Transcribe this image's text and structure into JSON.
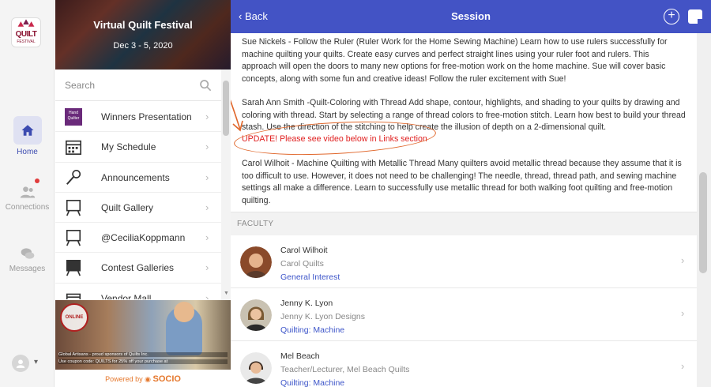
{
  "rail": {
    "logo_word": "QUILT",
    "logo_sub": "FESTIVAL",
    "items": [
      {
        "label": "Home",
        "icon": "home-icon"
      },
      {
        "label": "Connections",
        "icon": "people-icon"
      },
      {
        "label": "Messages",
        "icon": "chat-icon"
      }
    ],
    "accent": "#3c4bb0",
    "notification_color": "#e03c3c"
  },
  "event": {
    "title": "Virtual Quilt Festival",
    "dates": "Dec 3 - 5, 2020"
  },
  "search": {
    "placeholder": "Search"
  },
  "menu": {
    "items": [
      {
        "label": "Winners Presentation",
        "icon": "hq-logo-icon"
      },
      {
        "label": "My Schedule",
        "icon": "calendar-icon"
      },
      {
        "label": "Announcements",
        "icon": "microphone-icon"
      },
      {
        "label": "Quilt Gallery",
        "icon": "easel-icon"
      },
      {
        "label": "@CeciliaKoppmann",
        "icon": "easel-icon"
      },
      {
        "label": "Contest Galleries",
        "icon": "easel-icon"
      },
      {
        "label": "Vendor Mall",
        "icon": "store-icon"
      }
    ],
    "hq_logo_text": "Hand Quilter"
  },
  "ad": {
    "stamp": "ONLINE",
    "line1": "Global Artisans - proud sponsors of Quilts Inc.",
    "line2": "Use coupon code: QUILTS for 25% off your purchase at"
  },
  "powered": {
    "prefix": "Powered by",
    "brand": "SOCIO"
  },
  "topbar": {
    "back_label": "Back",
    "title": "Session",
    "color": "#4353c5"
  },
  "session": {
    "paragraphs": [
      "Sue Nickels - Follow the Ruler (Ruler Work for the Home Sewing Machine) Learn how to use rulers successfully for machine quilting your quilts. Create easy curves and perfect straight lines using your ruler foot and rulers. This approach will open the doors to many new options for free-motion work on the home machine. Sue will cover basic concepts, along with some fun and creative ideas! Follow the ruler excitement with Sue!",
      "Sarah Ann Smith -Quilt-Coloring with Thread Add shape, contour, highlights, and shading to your quilts by drawing and coloring with thread. Start by selecting a range of thread colors to free-motion stitch. Learn how best to build your thread stash. Use the direction of the stitching to help create the illusion of depth on a 2-dimensional quilt.",
      "Carol Wilhoit - Machine Quilting with Metallic Thread Many quilters avoid metallic thread because they assume that it is too difficult to use. However, it does not need to be challenging! The needle, thread, thread path, and sewing machine settings all make a difference. Learn to successfully use metallic thread for both walking foot quilting and free-motion quilting."
    ],
    "update_note": "UPDATE! Please see video below in Links section",
    "update_color": "#e02020",
    "annotation_color": "#e0662a"
  },
  "faculty": {
    "header": "FACULTY",
    "people": [
      {
        "name": "Carol Wilhoit",
        "org": "Carol Quilts",
        "track": "General Interest"
      },
      {
        "name": "Jenny K. Lyon",
        "org": "Jenny K. Lyon Designs",
        "track": "Quilting: Machine"
      },
      {
        "name": "Mel Beach",
        "org": "Teacher/Lecturer, Mel Beach Quilts",
        "track": "Quilting: Machine"
      }
    ],
    "link_color": "#3d55c9"
  }
}
